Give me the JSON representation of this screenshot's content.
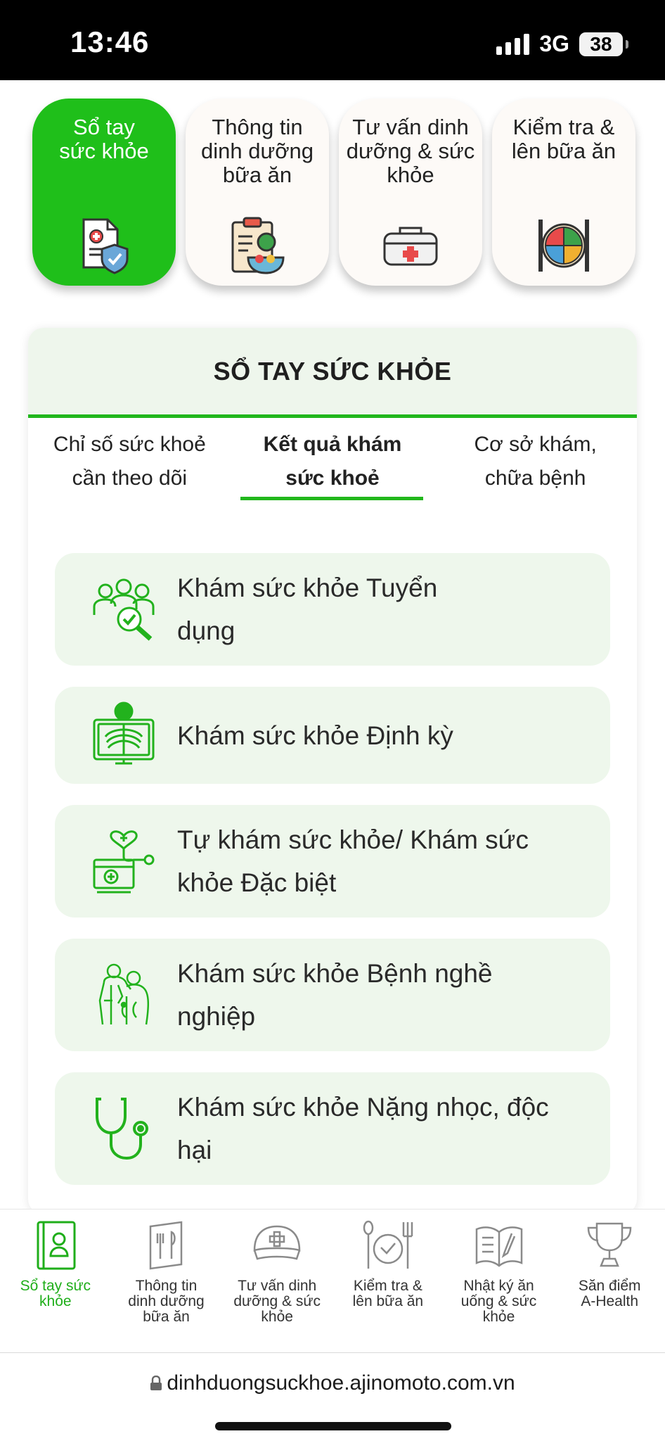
{
  "status": {
    "time": "13:46",
    "network": "3G",
    "battery": "38"
  },
  "top_categories": [
    {
      "label": "Sổ tay sức khỏe",
      "icon": "health-record-shield-icon",
      "active": true
    },
    {
      "label": "Thông tin dinh dưỡng bữa ăn",
      "icon": "clipboard-food-icon",
      "active": false
    },
    {
      "label": "Tư vấn dinh dưỡng & sức khỏe",
      "icon": "first-aid-kit-icon",
      "active": false
    },
    {
      "label": "Kiểm tra & lên bữa ăn",
      "icon": "plate-cutlery-icon",
      "active": false
    }
  ],
  "card": {
    "title": "SỔ TAY SỨC KHỎE",
    "subtabs": [
      {
        "label": "Chỉ số sức khoẻ cần theo dõi",
        "active": false
      },
      {
        "label": "Kết quả khám sức khoẻ",
        "active": true
      },
      {
        "label": "Cơ sở khám, chữa bệnh",
        "active": false
      }
    ],
    "items": [
      {
        "label": "Khám sức khỏe Tuyển dụng",
        "icon": "recruitment-check-icon"
      },
      {
        "label": "Khám sức khỏe Định kỳ",
        "icon": "xray-icon"
      },
      {
        "label": "Tự khám sức khỏe/ Khám sức khỏe Đặc biệt",
        "icon": "medical-device-icon"
      },
      {
        "label": "Khám sức khỏe Bệnh nghề nghiệp",
        "icon": "doctor-patient-icon"
      },
      {
        "label": "Khám sức khỏe Nặng nhọc, độc hại",
        "icon": "stethoscope-icon"
      }
    ]
  },
  "bottom_nav": [
    {
      "label": "Sổ tay sức khỏe",
      "icon": "notebook-person-icon",
      "active": true
    },
    {
      "label": "Thông tin dinh dưỡng bữa ăn",
      "icon": "menu-cutlery-icon",
      "active": false
    },
    {
      "label": "Tư vấn dinh dưỡng & sức khỏe",
      "icon": "nurse-cap-icon",
      "active": false
    },
    {
      "label": "Kiểm tra & lên bữa ăn",
      "icon": "plate-check-icon",
      "active": false
    },
    {
      "label": "Nhật ký ăn uống & sức khỏe",
      "icon": "open-book-icon",
      "active": false
    },
    {
      "label": "Săn điểm A-Health",
      "icon": "trophy-icon",
      "active": false
    }
  ],
  "browser": {
    "url": "dinhduongsuckhoe.ajinomoto.com.vn"
  },
  "colors": {
    "accent": "#1fbf1a",
    "item_bg": "#eef7ec",
    "icon_green": "#22b21d"
  }
}
